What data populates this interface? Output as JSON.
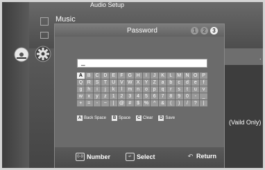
{
  "background": {
    "top_label": "Audio Setup",
    "menu_label": "Music",
    "valid_text": "(Vaild Only)",
    "dot_text": "."
  },
  "dialog": {
    "title": "Password",
    "steps": [
      "1",
      "2",
      "3"
    ],
    "active_step": 3,
    "password_value": "_"
  },
  "keyboard": {
    "rows": [
      [
        "A",
        "B",
        "C",
        "D",
        "E",
        "F",
        "G",
        "H",
        "I",
        "J",
        "K",
        "L",
        "M",
        "N",
        "O",
        "P"
      ],
      [
        "Q",
        "R",
        "S",
        "T",
        "U",
        "V",
        "W",
        "X",
        "Y",
        "Z",
        "a",
        "b",
        "c",
        "d",
        "e",
        "f"
      ],
      [
        "g",
        "h",
        "i",
        "j",
        "k",
        "l",
        "m",
        "n",
        "o",
        "p",
        "q",
        "r",
        "s",
        "t",
        "u",
        "v"
      ],
      [
        "w",
        "x",
        "y",
        "z",
        "1",
        "2",
        "3",
        "4",
        "5",
        "6",
        "7",
        "8",
        "9",
        "0",
        "-",
        "_"
      ],
      [
        "+",
        "=",
        "-",
        "~",
        "|",
        "@",
        "#",
        "$",
        "%",
        "^",
        "&",
        "(",
        ")",
        "/",
        "?",
        "|"
      ]
    ],
    "selected": "A",
    "commands": [
      {
        "key": "A",
        "label": "Back Space"
      },
      {
        "key": "B",
        "label": "Space"
      },
      {
        "key": "C",
        "label": "Clear"
      },
      {
        "key": "D",
        "label": "Save"
      }
    ]
  },
  "navigation": {
    "number_icon": "0-9",
    "number_label": "Number",
    "select_label": "Select",
    "return_label": "Return"
  },
  "icons": [
    "disc-icon",
    "gear-icon",
    "enter-icon",
    "return-icon"
  ]
}
